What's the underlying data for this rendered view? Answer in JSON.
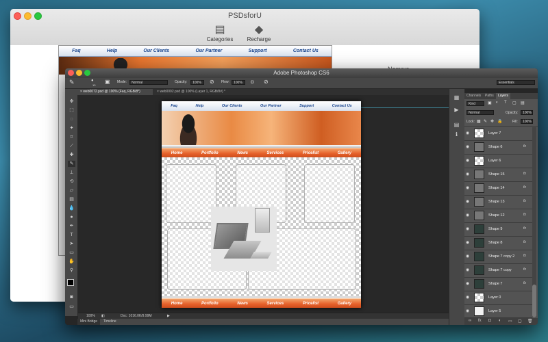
{
  "back_window": {
    "title": "PSDsforU",
    "toolbar": [
      {
        "label": "Categories",
        "icon": "categories-icon"
      },
      {
        "label": "Recharge",
        "icon": "diamond-icon"
      }
    ],
    "right_label": "Name:a",
    "preview_nav": [
      "Faq",
      "Help",
      "Our Clients",
      "Our Partner",
      "Support",
      "Contact Us"
    ]
  },
  "ps": {
    "title": "Adobe Photoshop CS6",
    "options": {
      "brush_size": "13",
      "mode_label": "Mode:",
      "mode_value": "Normal",
      "opacity_label": "Opacity:",
      "opacity_value": "100%",
      "flow_label": "Flow:",
      "flow_value": "100%",
      "workspace": "Essentials"
    },
    "doc_tabs": [
      "web0072.psd @ 100% (Faq, RGB/8*)",
      "web0002.psd @ 100% (Layer 1, RGB/8#) *"
    ],
    "doc": {
      "top_nav": [
        "Faq",
        "Help",
        "Our Clients",
        "Our Partner",
        "Support",
        "Contact Us"
      ],
      "main_nav": [
        "Home",
        "Portfolio",
        "News",
        "Services",
        "Pricelist",
        "Gallery"
      ],
      "footer_nav": [
        "Home",
        "Portfolio",
        "News",
        "Services",
        "Pricelist",
        "Gallery"
      ]
    },
    "status": {
      "zoom": "100%",
      "doc": "Doc: 1016.0K/9.99M"
    },
    "bottom_tabs": [
      "Mini Bridge",
      "Timeline"
    ],
    "panel": {
      "tabs": [
        "Channels",
        "Paths",
        "Layers"
      ],
      "kind_label": "Kind",
      "blend_mode": "Normal",
      "opacity_label": "Opacity:",
      "opacity_value": "100%",
      "lock_label": "Lock:",
      "fill_label": "Fill:",
      "fill_value": "100%",
      "fx_label": "fx",
      "layers": [
        "Layer 7",
        "Shape 6",
        "Layer 6",
        "Shape 15",
        "Shape 14",
        "Shape 13",
        "Shape 12",
        "Shape 9",
        "Shape 8",
        "Shape 7 copy 2",
        "Shape 7 copy",
        "Shape 7",
        "Layer 0",
        "Layer 5"
      ]
    }
  },
  "colors": {
    "accent_orange": "#e6602a",
    "nav_blue": "#123f8a",
    "ps_bg": "#262626"
  }
}
